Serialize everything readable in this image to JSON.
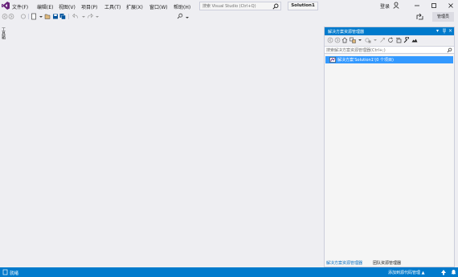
{
  "menu": [
    "文件(F)",
    "编辑(E)",
    "视图(V)",
    "项目(P)",
    "工具(T)",
    "扩展(X)",
    "窗口(W)",
    "帮助(H)"
  ],
  "search": {
    "placeholder": "搜索 Visual Studio (Ctrl+Q)"
  },
  "solution_name": "Solution1",
  "account": {
    "signin": "登录"
  },
  "toolbar": {
    "feedback": "管理员"
  },
  "left_tab": {
    "label": "工具箱"
  },
  "solution_explorer": {
    "title": "解决方案资源管理器",
    "search_placeholder": "搜索解决方案资源管理器(Ctrl+;)",
    "root_item": "解决方案'Solution1'(0 个项目)",
    "tabs": [
      "解决方案资源管理器",
      "团队资源管理器"
    ]
  },
  "statusbar": {
    "ready": "就绪",
    "source_control": "添加到源代码管理 ▲"
  },
  "colors": {
    "accent": "#007acc",
    "selection": "#3399ff",
    "background": "#eeeef2"
  }
}
